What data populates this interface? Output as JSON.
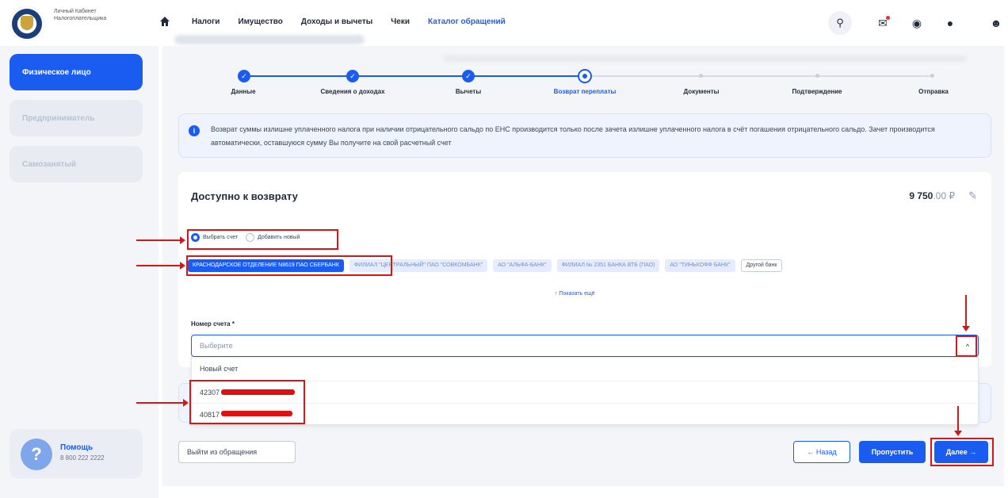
{
  "header": {
    "logo_text": "Личный Кабинет Налогоплательщика",
    "nav": [
      {
        "label": "Налоги"
      },
      {
        "label": "Имущество"
      },
      {
        "label": "Доходы и вычеты"
      },
      {
        "label": "Чеки"
      },
      {
        "label": "Каталог обращений"
      }
    ],
    "icons": [
      "search-icon",
      "mail-icon",
      "eye-off-icon",
      "lightbulb-icon",
      "user-icon"
    ]
  },
  "sidebar": {
    "items": [
      {
        "label": "Физическое лицо"
      },
      {
        "label": "Предприниматель"
      },
      {
        "label": "Самозанятый"
      }
    ],
    "help": {
      "title": "Помощь",
      "phone": "8 800 222 2222"
    }
  },
  "stepper": {
    "steps": [
      {
        "label": "Данные",
        "state": "done"
      },
      {
        "label": "Сведения о доходах",
        "state": "done"
      },
      {
        "label": "Вычеты",
        "state": "done"
      },
      {
        "label": "Возврат переплаты",
        "state": "current"
      },
      {
        "label": "Документы",
        "state": "todo"
      },
      {
        "label": "Подтверждение",
        "state": "todo"
      },
      {
        "label": "Отправка",
        "state": "todo"
      }
    ]
  },
  "info": {
    "text": "Возврат суммы излишне уплаченного налога при наличии отрицательного сальдо по ЕНС производится только после зачета излишне уплаченного налога в счёт погашения отрицательного сальдо. Зачет производится автоматически, оставшуюся сумму Вы получите на свой расчетный счет"
  },
  "refund": {
    "title": "Доступно к возврату",
    "amount_main": "9 750",
    "amount_sub": ".00 ₽",
    "radio": [
      {
        "label": "Выбрать счет",
        "selected": true
      },
      {
        "label": "Добавить новый",
        "selected": false
      }
    ],
    "banks": [
      {
        "label": "КРАСНОДАРСКОЕ ОТДЕЛЕНИЕ N8619 ПАО СБЕРБАНК",
        "selected": true
      },
      {
        "label": "ФИЛИАЛ \"ЦЕНТРАЛЬНЫЙ\" ПАО \"СОВКОМБАНК\"",
        "selected": false
      },
      {
        "label": "АО \"АЛЬФА-БАНК\"",
        "selected": false
      },
      {
        "label": "ФИЛИАЛ № 2351 БАНКА ВТБ (ПАО)",
        "selected": false
      },
      {
        "label": "АО \"ТИНЬКОФФ БАНК\"",
        "selected": false
      }
    ],
    "other_bank": "Другой банк",
    "show_more": "↑ Показать ещё",
    "account_label": "Номер счета *",
    "account_placeholder": "Выберите",
    "dropdown_options": [
      {
        "label": "Новый счет"
      },
      {
        "label": "42307"
      },
      {
        "label": "40817"
      }
    ]
  },
  "actions": {
    "exit": "Выйти из обращения",
    "back": "← Назад",
    "skip": "Пропустить",
    "next": "Далее →"
  },
  "colors": {
    "accent": "#1a5bf0",
    "annotation": "#d61717"
  }
}
